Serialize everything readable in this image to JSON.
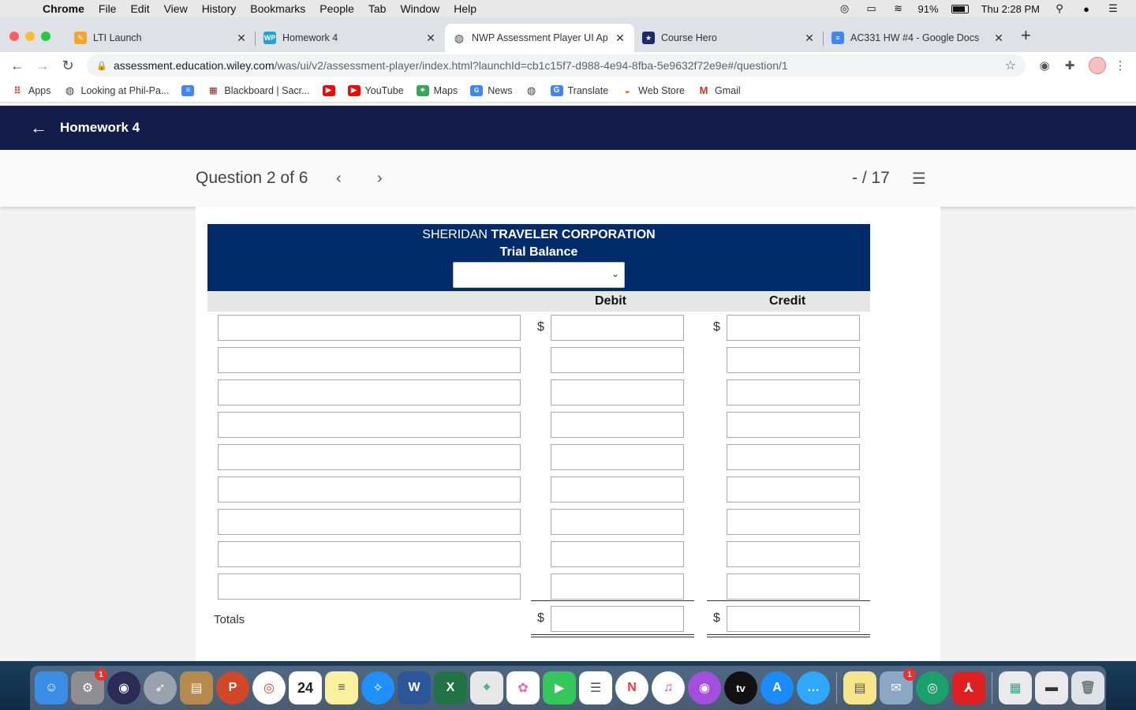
{
  "menubar": {
    "app": "Chrome",
    "items": [
      "File",
      "Edit",
      "View",
      "History",
      "Bookmarks",
      "People",
      "Tab",
      "Window",
      "Help"
    ],
    "battery": "91%",
    "clock": "Thu 2:28 PM"
  },
  "tabs": [
    {
      "title": "LTI Launch",
      "favicon_color": "#f4a52b"
    },
    {
      "title": "Homework 4",
      "favicon_color": "#1fa2e0",
      "favicon_text": "WP"
    },
    {
      "title": "NWP Assessment Player UI Ap",
      "favicon_color": "#444444"
    },
    {
      "title": "Course Hero",
      "favicon_color": "#1b2a6b"
    },
    {
      "title": "AC331 HW #4 - Google Docs",
      "favicon_color": "#4285f4"
    }
  ],
  "address": {
    "host": "assessment.education.wiley.com",
    "path": "/was/ui/v2/assessment-player/index.html?launchId=cb1c15f7-d988-4e94-8fba-5e9632f72e9e#/question/1"
  },
  "bookmarks": [
    {
      "label": "Apps",
      "icon": "apps-grid-icon"
    },
    {
      "label": "Looking at Phil-Pa...",
      "icon": "globe-icon"
    },
    {
      "label": "",
      "icon": "docs-icon"
    },
    {
      "label": "Blackboard | Sacr...",
      "icon": "blackboard-icon"
    },
    {
      "label": "",
      "icon": "youtube-icon"
    },
    {
      "label": "YouTube",
      "icon": "youtube-icon"
    },
    {
      "label": "Maps",
      "icon": "maps-icon"
    },
    {
      "label": "News",
      "icon": "news-icon"
    },
    {
      "label": "",
      "icon": "globe-icon"
    },
    {
      "label": "Translate",
      "icon": "translate-icon"
    },
    {
      "label": "Web Store",
      "icon": "webstore-icon"
    },
    {
      "label": "Gmail",
      "icon": "gmail-icon"
    }
  ],
  "header": {
    "back_label": "Homework 4"
  },
  "question": {
    "position": "Question 2 of 6",
    "score": "- / 17"
  },
  "trial_balance": {
    "company_normal": "SHERIDAN",
    "company_bold": "TRAVELER CORPORATION",
    "title": "Trial Balance",
    "date_select_value": "",
    "col_debit": "Debit",
    "col_credit": "Credit",
    "currency": "$",
    "rows": 9,
    "totals_label": "Totals"
  },
  "colors": {
    "app_header": "#141c4a",
    "table_header": "#002b6b"
  }
}
